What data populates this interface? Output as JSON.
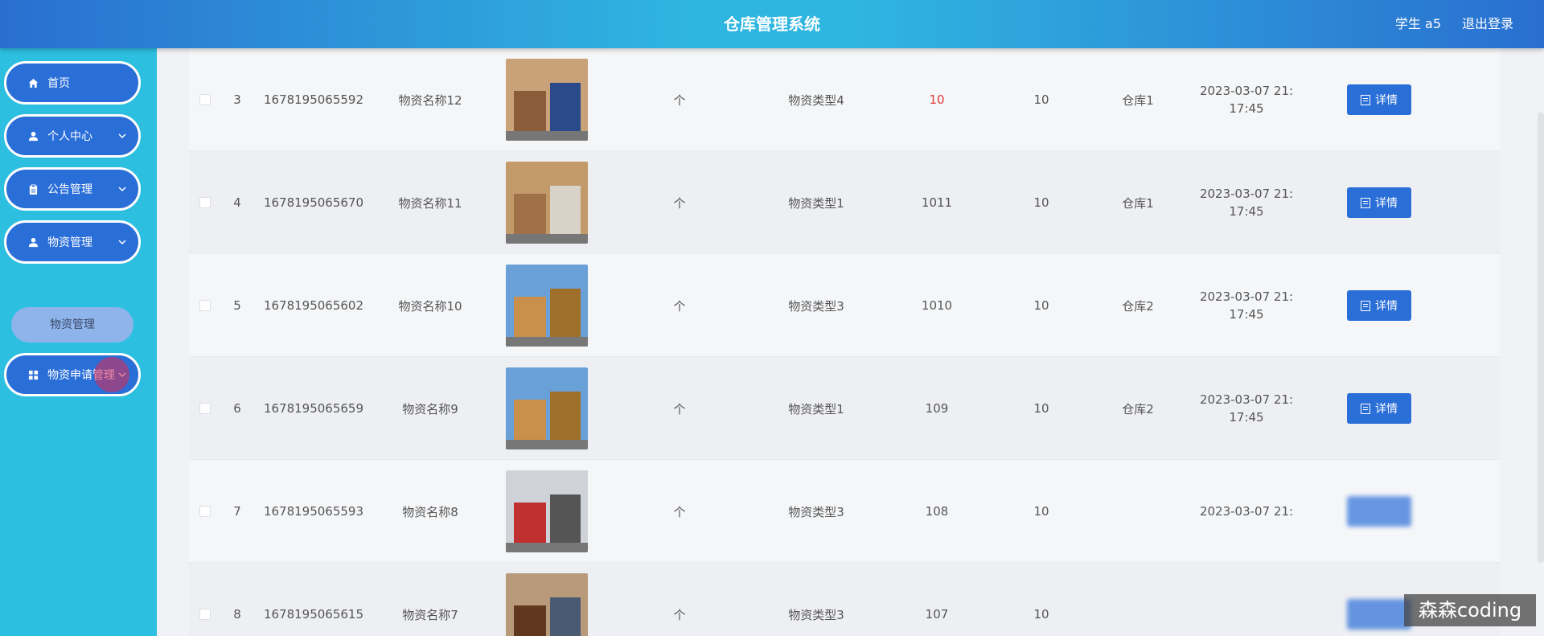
{
  "header": {
    "title": "仓库管理系统",
    "user": "学生 a5",
    "logout": "退出登录"
  },
  "sidebar": {
    "items": [
      {
        "label": "首页",
        "icon": "home-icon"
      },
      {
        "label": "个人中心",
        "icon": "user-icon"
      },
      {
        "label": "公告管理",
        "icon": "clipboard-icon"
      },
      {
        "label": "物资管理",
        "icon": "user-icon"
      },
      {
        "label": "物资申请管理",
        "icon": "grid-icon"
      }
    ],
    "submenu": {
      "label": "物资管理"
    }
  },
  "colors": {
    "accent": "#2a6ed8",
    "sidebar": "#2dbfe0",
    "alert": "#e23b3b"
  },
  "table": {
    "rows": [
      {
        "index": "3",
        "code": "1678195065592",
        "name": "物资名称12",
        "unit": "个",
        "type": "物资类型4",
        "qty": "10",
        "qty_alert": true,
        "warn": "10",
        "warehouse": "仓库1",
        "time": "2023-03-07 21:",
        "time2": "17:45",
        "detail": "详情"
      },
      {
        "index": "4",
        "code": "1678195065670",
        "name": "物资名称11",
        "unit": "个",
        "type": "物资类型1",
        "qty": "1011",
        "qty_alert": false,
        "warn": "10",
        "warehouse": "仓库1",
        "time": "2023-03-07 21:",
        "time2": "17:45",
        "detail": "详情"
      },
      {
        "index": "5",
        "code": "1678195065602",
        "name": "物资名称10",
        "unit": "个",
        "type": "物资类型3",
        "qty": "1010",
        "qty_alert": false,
        "warn": "10",
        "warehouse": "仓库2",
        "time": "2023-03-07 21:",
        "time2": "17:45",
        "detail": "详情"
      },
      {
        "index": "6",
        "code": "1678195065659",
        "name": "物资名称9",
        "unit": "个",
        "type": "物资类型1",
        "qty": "109",
        "qty_alert": false,
        "warn": "10",
        "warehouse": "仓库2",
        "time": "2023-03-07 21:",
        "time2": "17:45",
        "detail": "详情"
      },
      {
        "index": "7",
        "code": "1678195065593",
        "name": "物资名称8",
        "unit": "个",
        "type": "物资类型3",
        "qty": "108",
        "qty_alert": false,
        "warn": "10",
        "warehouse": "",
        "time": "2023-03-07 21:",
        "time2": "",
        "detail": ""
      },
      {
        "index": "8",
        "code": "1678195065615",
        "name": "物资名称7",
        "unit": "个",
        "type": "物资类型3",
        "qty": "107",
        "qty_alert": false,
        "warn": "10",
        "warehouse": "",
        "time": "",
        "time2": "",
        "detail": ""
      }
    ]
  },
  "watermark": "森森coding"
}
